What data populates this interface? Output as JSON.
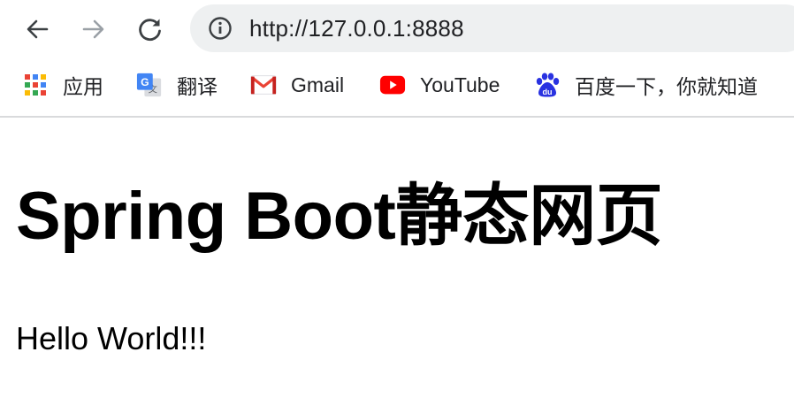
{
  "browser": {
    "url": "http://127.0.0.1:8888"
  },
  "icons": {
    "back": "arrow-left-icon",
    "forward": "arrow-right-icon",
    "reload": "reload-icon",
    "site_info": "info-icon",
    "apps": "apps-grid-icon",
    "translate": "google-translate-icon",
    "gmail": "gmail-icon",
    "youtube": "youtube-icon",
    "baidu": "baidu-paw-icon"
  },
  "bookmarks": [
    {
      "label": "应用"
    },
    {
      "label": "翻译"
    },
    {
      "label": "Gmail"
    },
    {
      "label": "YouTube"
    },
    {
      "label": "百度一下，你就知道"
    }
  ],
  "page": {
    "title": "Spring Boot静态网页",
    "body": "Hello World!!!"
  },
  "colors": {
    "omnibox_bg": "#eef0f1",
    "youtube_red": "#ff0000",
    "baidu_blue": "#2932e1",
    "gmail_red": "#ea4335"
  }
}
